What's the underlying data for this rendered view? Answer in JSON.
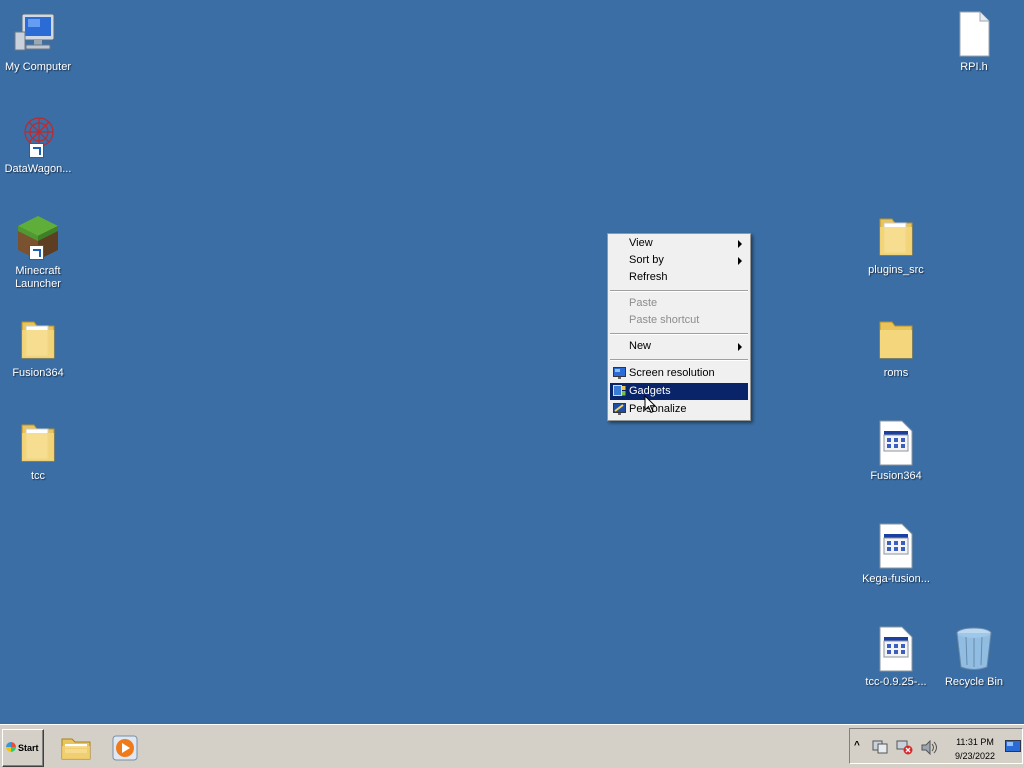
{
  "desktop": {
    "icons": [
      {
        "label": "My Computer"
      },
      {
        "label": "DataWagon..."
      },
      {
        "label": "Minecraft Launcher"
      },
      {
        "label": "Fusion364"
      },
      {
        "label": "tcc"
      },
      {
        "label": "RPI.h"
      },
      {
        "label": "plugins_src"
      },
      {
        "label": "roms"
      },
      {
        "label": "Fusion364"
      },
      {
        "label": "Kega-fusion..."
      },
      {
        "label": "tcc-0.9.25-..."
      },
      {
        "label": "Recycle Bin"
      }
    ]
  },
  "context_menu": {
    "items": [
      {
        "label": "View",
        "submenu": true
      },
      {
        "label": "Sort by",
        "submenu": true
      },
      {
        "label": "Refresh"
      },
      {
        "label": "Paste",
        "disabled": true
      },
      {
        "label": "Paste shortcut",
        "disabled": true
      },
      {
        "label": "New",
        "submenu": true
      },
      {
        "label": "Screen resolution"
      },
      {
        "label": "Gadgets",
        "highlighted": true
      },
      {
        "label": "Personalize"
      }
    ]
  },
  "taskbar": {
    "start_label": "Start",
    "clock_time": "11:31 PM",
    "clock_date": "9/23/2022"
  },
  "colors": {
    "desktop": "#3a6ea5",
    "menu_highlight": "#0a246a",
    "taskbar": "#d4d0c8"
  }
}
